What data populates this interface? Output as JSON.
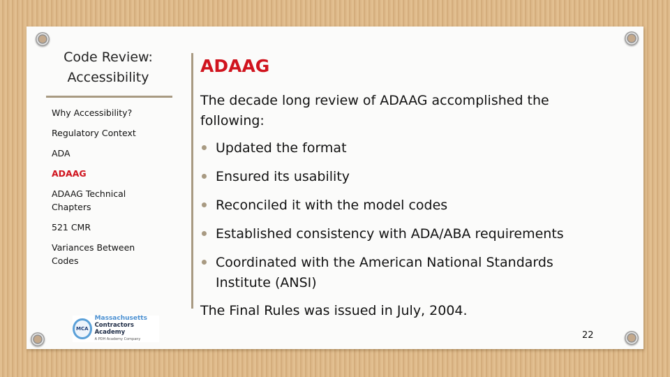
{
  "sidebar": {
    "title_line1": "Code Review:",
    "title_line2": "Accessibility",
    "items": [
      {
        "label": "Why Accessibility?"
      },
      {
        "label": "Regulatory Context"
      },
      {
        "label": "ADA"
      },
      {
        "label": "ADAAG",
        "active": true
      },
      {
        "label": "ADAAG Technical Chapters"
      },
      {
        "label": "521 CMR"
      },
      {
        "label": "Variances Between Codes"
      }
    ],
    "logo": {
      "seal": "MCA",
      "line1": "Massachusetts",
      "line2": "Contractors Academy",
      "line3": "A PDH Academy Company"
    }
  },
  "main": {
    "title": "ADAAG",
    "intro": "The decade long review of ADAAG accomplished the following:",
    "bullets": [
      "Updated the format",
      "Ensured its usability",
      "Reconciled it with the model codes",
      "Established consistency with ADA/ABA requirements",
      "Coordinated with the American National Standards Institute (ANSI)"
    ],
    "closing": "The Final Rules was issued in July, 2004."
  },
  "page_number": "22",
  "colors": {
    "accent_red": "#d0141e",
    "rule_taupe": "#a89a82",
    "background_cardboard": "#deb887"
  }
}
